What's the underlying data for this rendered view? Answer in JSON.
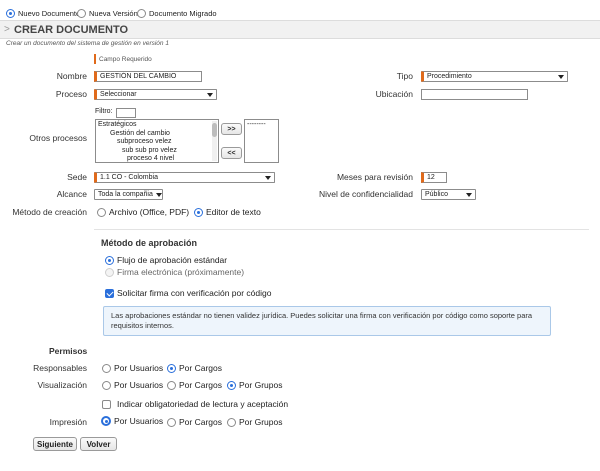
{
  "doc_type_options": [
    {
      "label": "Nuevo Documento",
      "selected": true
    },
    {
      "label": "Nueva Versión",
      "selected": false
    },
    {
      "label": "Documento Migrado",
      "selected": false
    }
  ],
  "header": {
    "title": "CREAR DOCUMENTO",
    "subtitle": "Crear un documento del sistema de gestión en versión 1"
  },
  "required_note": "Campo Requerido",
  "form": {
    "nombre_label": "Nombre",
    "nombre_value": "GESTIÓN DEL CAMBIO",
    "tipo_label": "Tipo",
    "tipo_value": "Procedimiento",
    "proceso_label": "Proceso",
    "proceso_value": "Seleccionar",
    "ubicacion_label": "Ubicación",
    "ubicacion_value": "",
    "otros_label": "Otros procesos",
    "filtro_label": "Filtro:",
    "filtro_value": "",
    "process_list": [
      "Estratégicos",
      "Gestión del cambio",
      "subproceso velez",
      "sub sub pro velez",
      "proceso 4 nivel"
    ],
    "add_button": ">>",
    "remove_button": "<<",
    "selected_list": [
      "--------"
    ],
    "sede_label": "Sede",
    "sede_value": "1.1 CO - Colombia",
    "meses_label": "Meses para revisión",
    "meses_value": "12",
    "alcance_label": "Alcance",
    "alcance_value": "Toda la compañia",
    "nivel_label": "Nivel de confidencialidad",
    "nivel_value": "Público",
    "metodo_label": "Método de creación",
    "metodo_options": [
      {
        "label": "Archivo (Office, PDF)",
        "selected": false
      },
      {
        "label": "Editor de texto",
        "selected": true
      }
    ]
  },
  "approval": {
    "title": "Método de aprobación",
    "options": [
      {
        "label": "Flujo de aprobación estándar",
        "selected": true,
        "disabled": false
      },
      {
        "label": "Firma electrónica (próximamente)",
        "selected": false,
        "disabled": true
      }
    ],
    "checkbox_label": "Solicitar firma con verificación por código",
    "checkbox_checked": true,
    "info_text": "Las aprobaciones estándar no tienen validez jurídica. Puedes solicitar una firma con verificación por código como soporte para requisitos internos."
  },
  "permissions": {
    "title": "Permisos",
    "responsables_label": "Responsables",
    "responsables_options": [
      {
        "label": "Por Usuarios",
        "selected": false
      },
      {
        "label": "Por Cargos",
        "selected": true
      }
    ],
    "visualizacion_label": "Visualización",
    "visualizacion_options": [
      {
        "label": "Por Usuarios",
        "selected": false
      },
      {
        "label": "Por Cargos",
        "selected": false
      },
      {
        "label": "Por Grupos",
        "selected": true
      }
    ],
    "obligatoriedad_label": "Indicar obligatoriedad de lectura y aceptación",
    "obligatoriedad_checked": false,
    "impresion_label": "Impresión",
    "impresion_options": [
      {
        "label": "Por Usuarios",
        "selected": true
      },
      {
        "label": "Por Cargos",
        "selected": false
      },
      {
        "label": "Por Grupos",
        "selected": false
      }
    ]
  },
  "buttons": {
    "siguiente": "Siguiente",
    "volver": "Volver"
  },
  "colors": {
    "accent": "#2a6fdb",
    "required": "#e06a1b",
    "info_bg": "#eef5fc",
    "info_border": "#aac8e8"
  }
}
